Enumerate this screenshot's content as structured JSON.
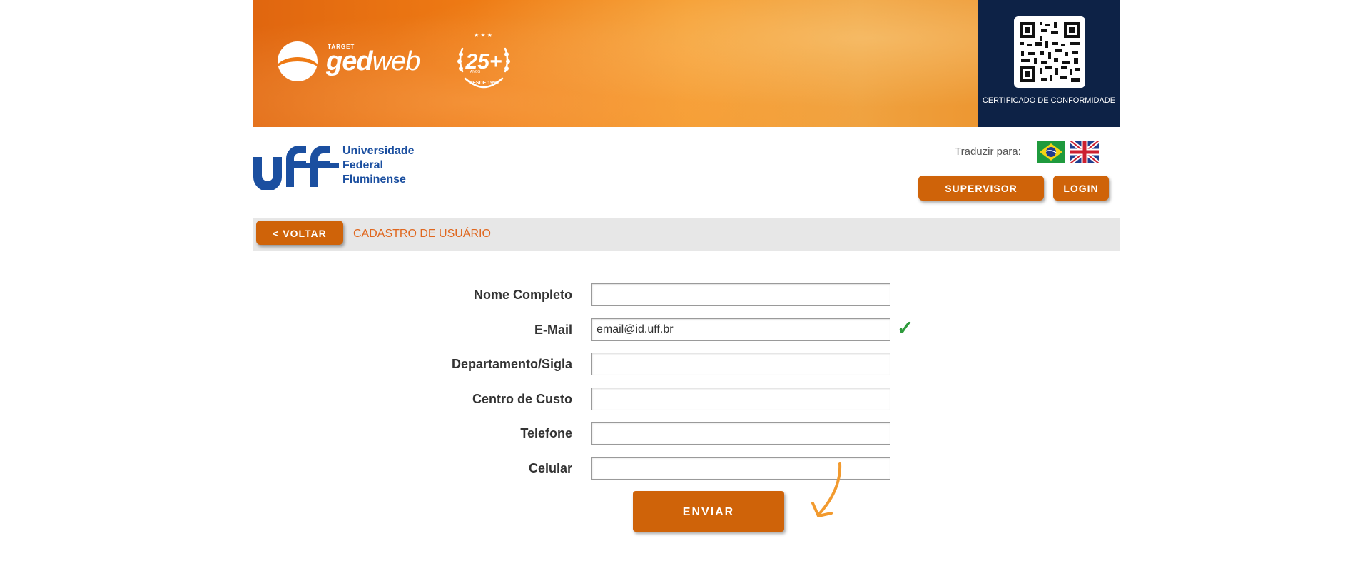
{
  "banner": {
    "logo_small_text": "TARGET",
    "logo_ged": "ged",
    "logo_web": "web",
    "seal_number": "25+",
    "seal_small": "ANOS",
    "seal_since": "DESDE 1996",
    "qr_caption": "CERTIFICADO DE CONFORMIDADE"
  },
  "header": {
    "uff_logo_text": "uff",
    "university_line1": "Universidade",
    "university_line2": "Federal",
    "university_line3": "Fluminense",
    "translate_label": "Traduzir para:",
    "flags": [
      "brazil-flag-icon",
      "uk-flag-icon"
    ],
    "supervisor_label": "SUPERVISOR",
    "login_label": "LOGIN"
  },
  "titlebar": {
    "back_label": "< VOLTAR",
    "title": "CADASTRO DE USUÁRIO"
  },
  "form": {
    "fields": [
      {
        "label": "Nome Completo",
        "value": ""
      },
      {
        "label": "E-Mail",
        "value": "email@id.uff.br",
        "valid": true
      },
      {
        "label": "Departamento/Sigla",
        "value": ""
      },
      {
        "label": "Centro de Custo",
        "value": ""
      },
      {
        "label": "Telefone",
        "value": ""
      },
      {
        "label": "Celular",
        "value": ""
      }
    ],
    "check_icon": "checkmark-icon",
    "submit_label": "ENVIAR"
  },
  "colors": {
    "accent": "#cf6309",
    "title_orange": "#e0671e",
    "navy": "#0d2246",
    "uff_blue": "#1b4fa0",
    "valid_green": "#2e9b3c",
    "arrow": "#f29a2e"
  }
}
